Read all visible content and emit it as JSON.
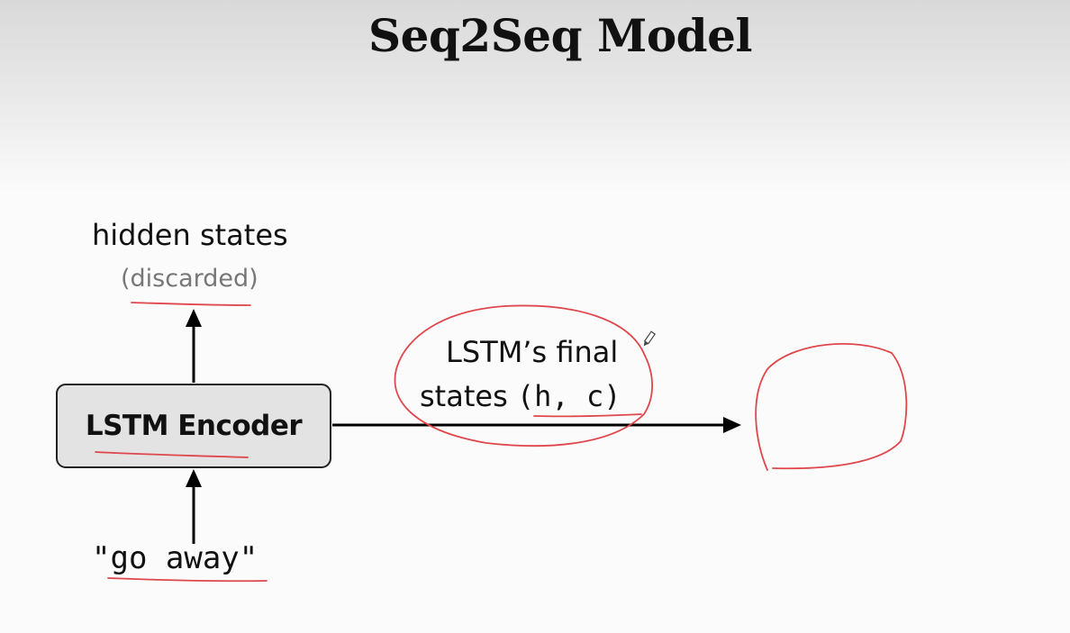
{
  "slide": {
    "title": "Seq2Seq Model"
  },
  "diagram": {
    "hidden_states_label": "hidden states",
    "discarded_label": "(discarded)",
    "encoder_label": "LSTM Encoder",
    "input_text": "\"go away\"",
    "final_states_line1": "LSTM’s final",
    "final_states_word": "states",
    "final_states_code": "(h, c)"
  },
  "colors": {
    "annotation": "#e0474c",
    "arrow": "#000000",
    "box_fill": "#e3e3e3"
  },
  "icons": {
    "pen_cursor": "pen-icon"
  }
}
